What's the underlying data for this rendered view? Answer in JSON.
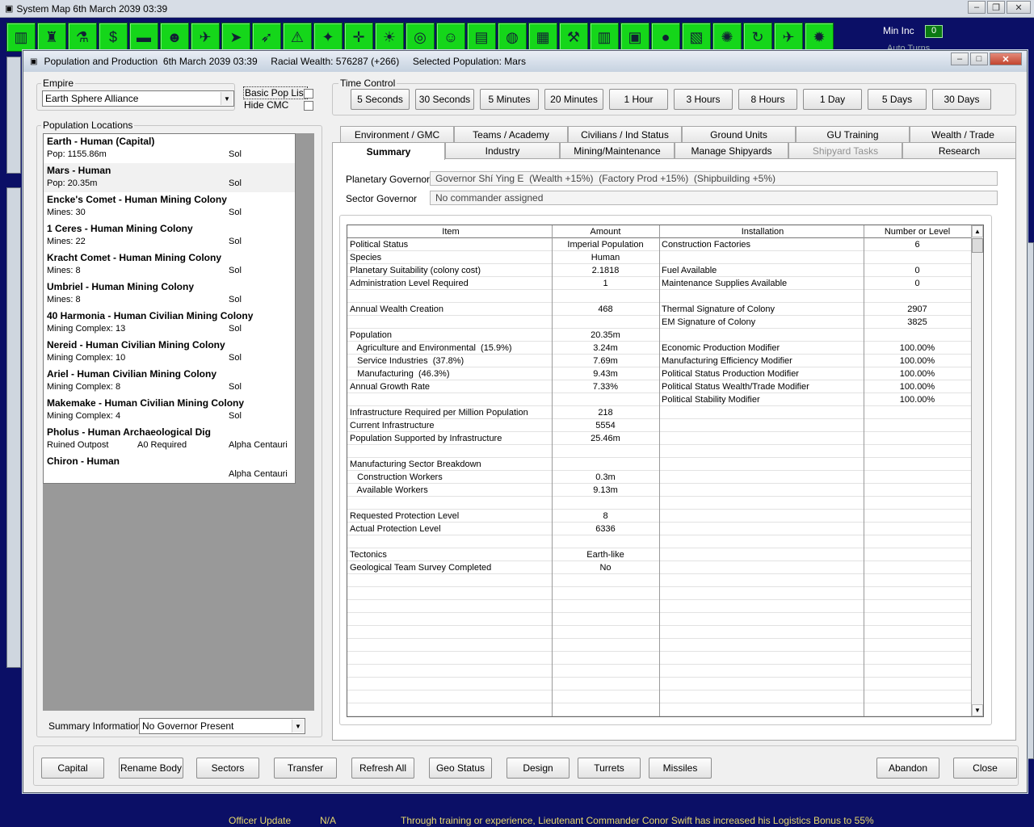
{
  "outer_window": {
    "title": "System Map  6th March 2039 03:39"
  },
  "toolbar": {
    "icons": [
      "city-icon",
      "factory-icon",
      "flask-icon",
      "money-bag-icon",
      "tank-icon",
      "commander-icon",
      "fighter-icon",
      "ship-icon",
      "missile-icon",
      "hazard-icon",
      "tie-ship-icon",
      "target-icon",
      "sun-icon",
      "radar-icon",
      "alien-icon",
      "book-icon",
      "globe-icon",
      "barrels-icon",
      "wrench-icon",
      "buildings-icon",
      "circuit-icon",
      "planet-icon",
      "graph-icon",
      "network-icon",
      "refresh-icon",
      "plane-icon",
      "star-badge-icon"
    ],
    "glyphs": [
      "▥",
      "♜",
      "⚗",
      "$",
      "▬",
      "☻",
      "✈",
      "➤",
      "➶",
      "⚠",
      "✦",
      "✛",
      "☀",
      "◎",
      "☺",
      "▤",
      "◍",
      "▦",
      "⚒",
      "▥",
      "▣",
      "●",
      "▧",
      "✺",
      "↻",
      "✈",
      "✹"
    ]
  },
  "min_inc": {
    "label": "Min Inc",
    "value": "0"
  },
  "auto_turns": {
    "label": "Auto Turns"
  },
  "window": {
    "title": "Population and Production  6th March 2039 03:39     Racial Wealth: 576287 (+266)     Selected Population: Mars"
  },
  "empire": {
    "label": "Empire",
    "value": "Earth Sphere Alliance"
  },
  "options": {
    "basic_pop_list": "Basic Pop List",
    "hide_cmc": "Hide CMC"
  },
  "time_control": {
    "label": "Time Control",
    "buttons": [
      "5 Seconds",
      "30 Seconds",
      "5 Minutes",
      "20 Minutes",
      "1 Hour",
      "3 Hours",
      "8 Hours",
      "1 Day",
      "5 Days",
      "30 Days"
    ]
  },
  "population_locations": {
    "label": "Population Locations",
    "items": [
      {
        "name": "Earth - Human (Capital)",
        "detail": "Pop: 1155.86m",
        "mid": "",
        "system": "Sol"
      },
      {
        "name": "Mars - Human",
        "detail": "Pop: 20.35m",
        "mid": "",
        "system": "Sol"
      },
      {
        "name": "Encke's Comet - Human Mining Colony",
        "detail": "Mines: 30",
        "mid": "",
        "system": "Sol"
      },
      {
        "name": "1 Ceres - Human Mining Colony",
        "detail": "Mines: 22",
        "mid": "",
        "system": "Sol"
      },
      {
        "name": "Kracht Comet - Human Mining Colony",
        "detail": "Mines: 8",
        "mid": "",
        "system": "Sol"
      },
      {
        "name": "Umbriel - Human Mining Colony",
        "detail": "Mines: 8",
        "mid": "",
        "system": "Sol"
      },
      {
        "name": "40 Harmonia - Human Civilian Mining Colony",
        "detail": "Mining Complex: 13",
        "mid": "",
        "system": "Sol"
      },
      {
        "name": "Nereid - Human Civilian Mining Colony",
        "detail": "Mining Complex: 10",
        "mid": "",
        "system": "Sol"
      },
      {
        "name": "Ariel - Human Civilian Mining Colony",
        "detail": "Mining Complex: 8",
        "mid": "",
        "system": "Sol"
      },
      {
        "name": "Makemake - Human Civilian Mining Colony",
        "detail": "Mining Complex: 4",
        "mid": "",
        "system": "Sol"
      },
      {
        "name": "Pholus - Human Archaeological Dig",
        "detail": "Ruined Outpost",
        "mid": "A0 Required",
        "system": "Alpha Centauri"
      },
      {
        "name": "Chiron - Human",
        "detail": "",
        "mid": "",
        "system": "Alpha Centauri"
      }
    ]
  },
  "summary_information": {
    "label": "Summary Information",
    "value": "No Governor Present"
  },
  "tabs_row1": [
    "Environment / GMC",
    "Teams / Academy",
    "Civilians / Ind Status",
    "Ground Units",
    "GU Training",
    "Wealth / Trade"
  ],
  "tabs_row2": [
    "Summary",
    "Industry",
    "Mining/Maintenance",
    "Manage Shipyards",
    "Shipyard Tasks",
    "Research"
  ],
  "governors": {
    "planetary_label": "Planetary Governor",
    "planetary_value": "Governor Shí Ying E  (Wealth +15%)  (Factory Prod +15%)  (Shipbuilding +5%)",
    "sector_label": "Sector Governor",
    "sector_value": "No commander assigned"
  },
  "grid": {
    "headers": [
      "Item",
      "Amount",
      "Installation",
      "Number or Level"
    ],
    "rows": [
      [
        "Political Status",
        "Imperial Population",
        "Construction Factories",
        "6"
      ],
      [
        "Species",
        "Human",
        "",
        ""
      ],
      [
        "Planetary Suitability (colony cost)",
        "2.1818",
        "Fuel Available",
        "0"
      ],
      [
        "Administration Level Required",
        "1",
        "Maintenance Supplies Available",
        "0"
      ],
      [
        "",
        "",
        "",
        ""
      ],
      [
        "Annual Wealth Creation",
        "468",
        "Thermal Signature of Colony",
        "2907"
      ],
      [
        "",
        "",
        "EM Signature of Colony",
        "3825"
      ],
      [
        "Population",
        "20.35m",
        "",
        ""
      ],
      [
        "   Agriculture and Environmental  (15.9%)",
        "3.24m",
        "Economic Production Modifier",
        "100.00%"
      ],
      [
        "   Service Industries  (37.8%)",
        "7.69m",
        "Manufacturing Efficiency Modifier",
        "100.00%"
      ],
      [
        "   Manufacturing  (46.3%)",
        "9.43m",
        "Political Status Production Modifier",
        "100.00%"
      ],
      [
        "Annual Growth Rate",
        "7.33%",
        "Political Status Wealth/Trade Modifier",
        "100.00%"
      ],
      [
        "",
        "",
        "Political Stability Modifier",
        "100.00%"
      ],
      [
        "Infrastructure Required per Million Population",
        "218",
        "",
        ""
      ],
      [
        "Current Infrastructure",
        "5554",
        "",
        ""
      ],
      [
        "Population Supported by Infrastructure",
        "25.46m",
        "",
        ""
      ],
      [
        "",
        "",
        "",
        ""
      ],
      [
        "Manufacturing Sector Breakdown",
        "",
        "",
        ""
      ],
      [
        "   Construction Workers",
        "0.3m",
        "",
        ""
      ],
      [
        "   Available Workers",
        "9.13m",
        "",
        ""
      ],
      [
        "",
        "",
        "",
        ""
      ],
      [
        "Requested Protection Level",
        "8",
        "",
        ""
      ],
      [
        "Actual Protection Level",
        "6336",
        "",
        ""
      ],
      [
        "",
        "",
        "",
        ""
      ],
      [
        "Tectonics",
        "Earth-like",
        "",
        ""
      ],
      [
        "Geological Team Survey Completed",
        "No",
        "",
        ""
      ]
    ]
  },
  "bottom_buttons": [
    "Capital",
    "Rename Body",
    "Sectors",
    "Transfer",
    "Refresh All",
    "Geo Status",
    "Design",
    "Turrets",
    "Missiles"
  ],
  "abandon_label": "Abandon",
  "close_label": "Close",
  "status_bar": {
    "type": "Officer Update",
    "location": "N/A",
    "message": "Through training or experience, Lieutenant Commander Conor Swift has increased his Logistics Bonus to 55%"
  }
}
